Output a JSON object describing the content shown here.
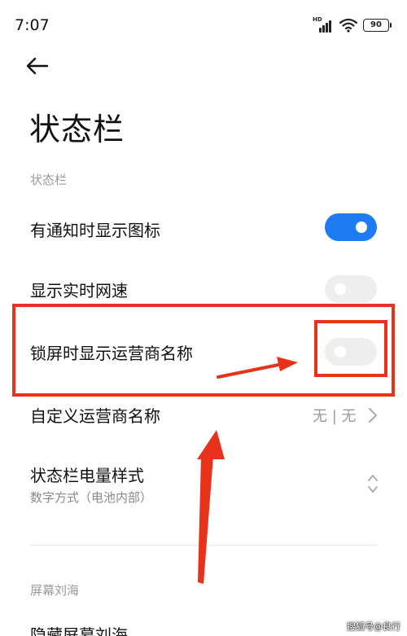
{
  "status_bar": {
    "time": "7:07",
    "network_badge": "HD",
    "battery_level": "90",
    "icons": [
      "signal-icon",
      "wifi-icon",
      "battery-icon"
    ]
  },
  "header": {
    "back_icon": "arrow-left-icon",
    "title": "状态栏"
  },
  "sections": [
    {
      "header": "状态栏",
      "items": [
        {
          "label": "有通知时显示图标",
          "type": "toggle",
          "value": true
        },
        {
          "label": "显示实时网速",
          "type": "toggle",
          "value": false
        },
        {
          "label": "锁屏时显示运营商名称",
          "type": "toggle",
          "value": false
        },
        {
          "label": "自定义运营商名称",
          "type": "link",
          "value": "无 | 无"
        },
        {
          "label": "状态栏电量样式",
          "sublabel": "数字方式（电池内部）",
          "type": "select"
        }
      ]
    },
    {
      "header": "屏幕刘海",
      "items": [
        {
          "label": "隐藏屏幕刘海",
          "type": "unknown"
        }
      ]
    }
  ],
  "colors": {
    "accent": "#1f7bf2",
    "toggle_off": "#eeeeee",
    "annotation": "#e8321c",
    "secondary_text": "#999999"
  },
  "watermark": "搜狐号@良行"
}
